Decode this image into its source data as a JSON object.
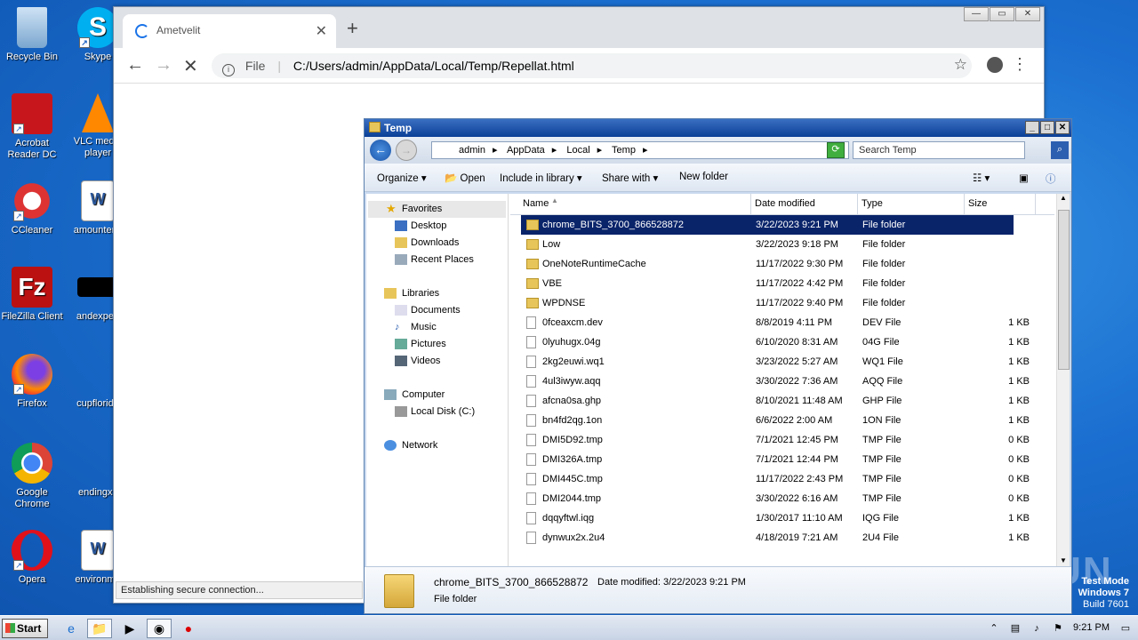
{
  "desktop": {
    "icons": [
      {
        "label": "Recycle Bin"
      },
      {
        "label": "Skype"
      },
      {
        "label": "Acrobat Reader DC"
      },
      {
        "label": "VLC media player"
      },
      {
        "label": "CCleaner"
      },
      {
        "label": "amountenc"
      },
      {
        "label": "FileZilla Client"
      },
      {
        "label": "andexperi"
      },
      {
        "label": "Firefox"
      },
      {
        "label": "cupflorida"
      },
      {
        "label": "Google Chrome"
      },
      {
        "label": "endingxx"
      },
      {
        "label": "Opera"
      },
      {
        "label": "environme"
      }
    ]
  },
  "chrome": {
    "tab_title": "Ametvelit",
    "url_scheme": "File",
    "url": "C:/Users/admin/AppData/Local/Temp/Repellat.html",
    "status": "Establishing secure connection..."
  },
  "explorer": {
    "title": "Temp",
    "breadcrumb": [
      "admin",
      "AppData",
      "Local",
      "Temp"
    ],
    "search_placeholder": "Search Temp",
    "commands": {
      "organize": "Organize",
      "open": "Open",
      "include": "Include in library",
      "share": "Share with",
      "new_folder": "New folder"
    },
    "nav": {
      "favorites": "Favorites",
      "desktop": "Desktop",
      "downloads": "Downloads",
      "recent": "Recent Places",
      "libraries": "Libraries",
      "documents": "Documents",
      "music": "Music",
      "pictures": "Pictures",
      "videos": "Videos",
      "computer": "Computer",
      "localdisk": "Local Disk (C:)",
      "network": "Network"
    },
    "columns": {
      "name": "Name",
      "date": "Date modified",
      "type": "Type",
      "size": "Size"
    },
    "rows": [
      {
        "name": "chrome_BITS_3700_866528872",
        "date": "3/22/2023 9:21 PM",
        "type": "File folder",
        "size": ""
      },
      {
        "name": "Low",
        "date": "3/22/2023 9:18 PM",
        "type": "File folder",
        "size": ""
      },
      {
        "name": "OneNoteRuntimeCache",
        "date": "11/17/2022 9:30 PM",
        "type": "File folder",
        "size": ""
      },
      {
        "name": "VBE",
        "date": "11/17/2022 4:42 PM",
        "type": "File folder",
        "size": ""
      },
      {
        "name": "WPDNSE",
        "date": "11/17/2022 9:40 PM",
        "type": "File folder",
        "size": ""
      },
      {
        "name": "0fceaxcm.dev",
        "date": "8/8/2019 4:11 PM",
        "type": "DEV File",
        "size": "1 KB"
      },
      {
        "name": "0lyuhugx.04g",
        "date": "6/10/2020 8:31 AM",
        "type": "04G File",
        "size": "1 KB"
      },
      {
        "name": "2kg2euwi.wq1",
        "date": "3/23/2022 5:27 AM",
        "type": "WQ1 File",
        "size": "1 KB"
      },
      {
        "name": "4ul3iwyw.aqq",
        "date": "3/30/2022 7:36 AM",
        "type": "AQQ File",
        "size": "1 KB"
      },
      {
        "name": "afcna0sa.ghp",
        "date": "8/10/2021 11:48 AM",
        "type": "GHP File",
        "size": "1 KB"
      },
      {
        "name": "bn4fd2qg.1on",
        "date": "6/6/2022 2:00 AM",
        "type": "1ON File",
        "size": "1 KB"
      },
      {
        "name": "DMI5D92.tmp",
        "date": "7/1/2021 12:45 PM",
        "type": "TMP File",
        "size": "0 KB"
      },
      {
        "name": "DMI326A.tmp",
        "date": "7/1/2021 12:44 PM",
        "type": "TMP File",
        "size": "0 KB"
      },
      {
        "name": "DMI445C.tmp",
        "date": "11/17/2022 2:43 PM",
        "type": "TMP File",
        "size": "0 KB"
      },
      {
        "name": "DMI2044.tmp",
        "date": "3/30/2022 6:16 AM",
        "type": "TMP File",
        "size": "0 KB"
      },
      {
        "name": "dqqyftwl.iqg",
        "date": "1/30/2017 11:10 AM",
        "type": "IQG File",
        "size": "1 KB"
      },
      {
        "name": "dynwux2x.2u4",
        "date": "4/18/2019 7:21 AM",
        "type": "2U4 File",
        "size": "1 KB"
      }
    ],
    "details": {
      "name": "chrome_BITS_3700_866528872",
      "date_label": "Date modified:",
      "date": "3/22/2023 9:21 PM",
      "type": "File folder"
    }
  },
  "taskbar": {
    "start": "Start",
    "clock": "9:21 PM"
  },
  "watermark": {
    "line1": "Test Mode",
    "line2": "Windows 7",
    "line3": "Build 7601",
    "brand": "ANY RUN"
  }
}
